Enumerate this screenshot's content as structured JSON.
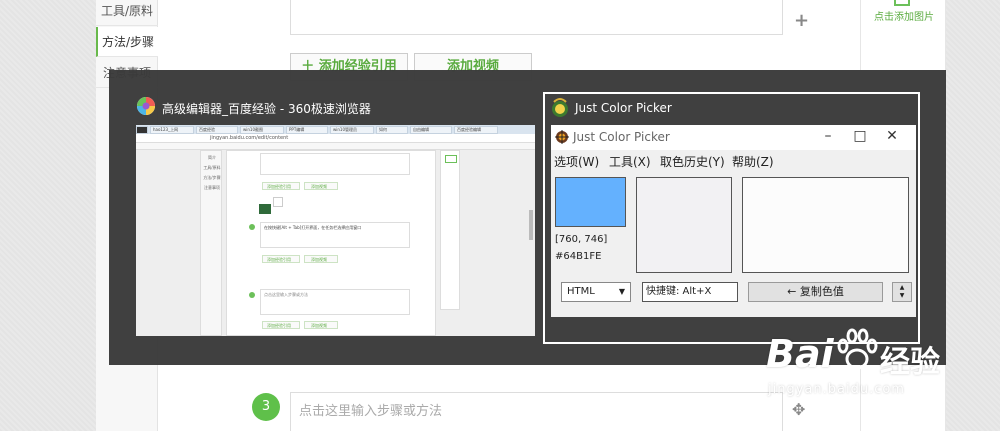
{
  "editor": {
    "sidebar": {
      "items": [
        "工具/原料",
        "方法/步骤",
        "注意事项"
      ]
    },
    "buttons": {
      "add_reference": "＋ 添加经验引用",
      "add_video": "添加视频"
    },
    "right_panel": {
      "add_image": "点击添加图片"
    },
    "step3": {
      "number": "3",
      "placeholder": "点击这里输入步骤或方法"
    },
    "plus_icon": "+",
    "move_icon": "✥"
  },
  "switcher": {
    "browser_title": "高级编辑器_百度经验 - 360极速浏览器",
    "picker_title": "Just Color Picker",
    "browser_thumb": {
      "url": "jingyan.baidu.com/edit/content",
      "tabs": [
        "hao123_上网",
        "百度经验",
        "win10截图",
        "PPT编辑",
        "win10管理员",
        "如何",
        "自由编辑",
        "百度经验编辑"
      ],
      "side_items": [
        "简介",
        "工具/原料",
        "方法/步骤",
        "注意事项"
      ],
      "step2_text": "在按快键[Alt + Tab]打开界面，在任务栏选择应用窗口",
      "step3_text": "点击这里输入步骤或方法",
      "btn_ref": "添加经验引用",
      "btn_video": "添加视频"
    }
  },
  "jcp": {
    "title": "Just Color Picker",
    "menu": [
      "选项(W)",
      "工具(X)",
      "取色历史(Y)",
      "帮助(Z)"
    ],
    "coords": "[760, 746]",
    "hex": "#64B1FE",
    "format": "HTML",
    "hotkey": "快捷键: Alt+X",
    "copy_button": "← 复制色值",
    "colors": {
      "picked": "#64B1FE",
      "swatch2": "#f2f1f3",
      "swatch3": "#fcfcfc"
    }
  },
  "watermark": {
    "brand": "Bai",
    "brand_end": "经验",
    "url": "jingyan.baidu.com"
  }
}
